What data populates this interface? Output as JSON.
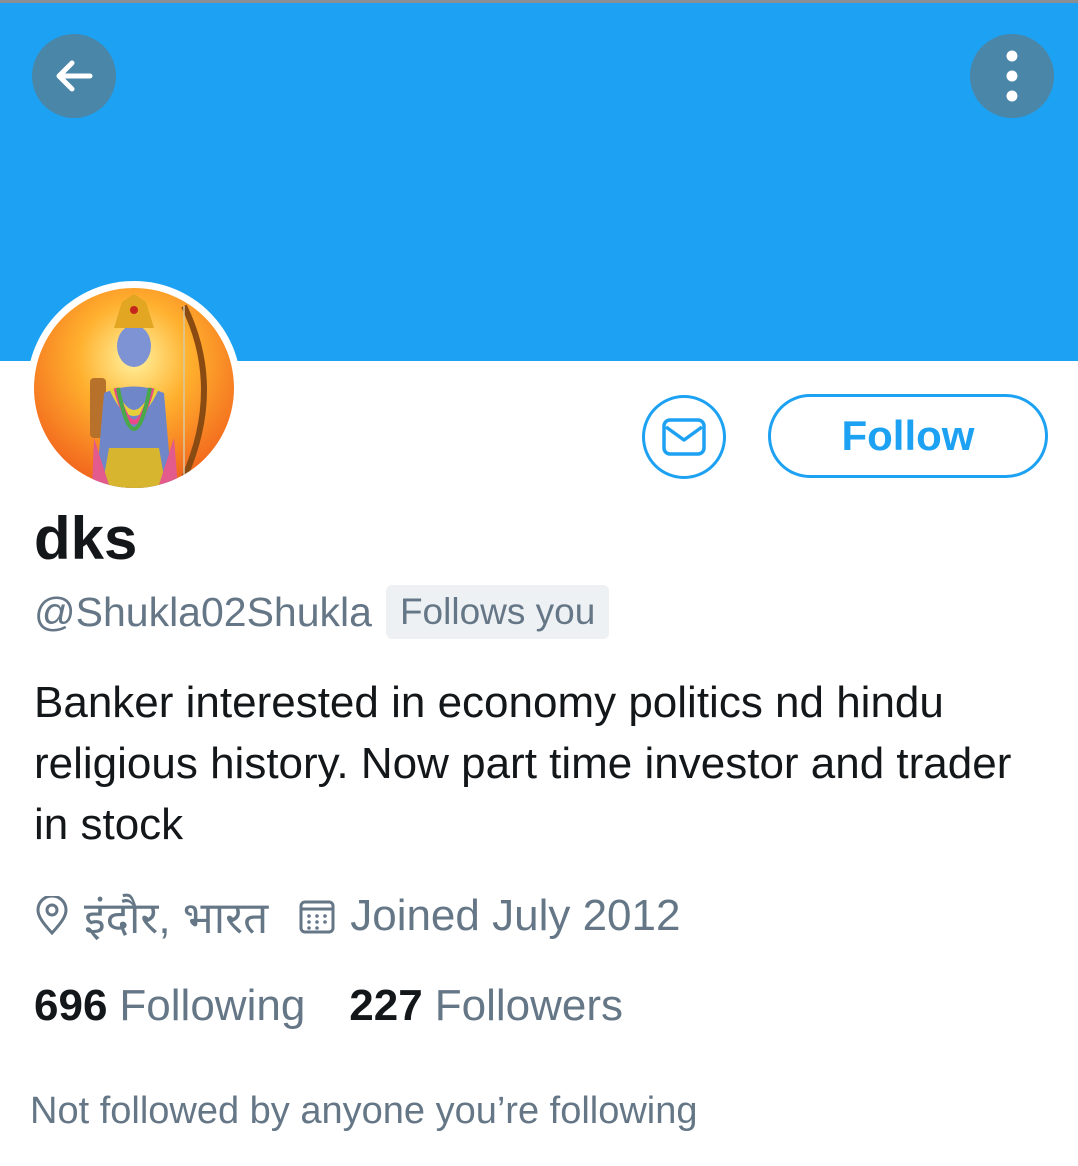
{
  "header": {
    "back_icon": "arrow-left-icon",
    "more_icon": "more-vertical-icon",
    "banner_color": "#1da1f2"
  },
  "profile": {
    "display_name": "dks",
    "handle": "@Shukla02Shukla",
    "follows_you_badge": "Follows you",
    "bio": "Banker interested in economy politics nd hindu religious history.  Now part time investor and trader in stock",
    "location": "इंदौर, भारत",
    "joined": "Joined July 2012"
  },
  "actions": {
    "message_icon": "envelope-icon",
    "follow_label": "Follow"
  },
  "stats": {
    "following_count": "696",
    "following_label": "Following",
    "followers_count": "227",
    "followers_label": "Followers"
  },
  "footer": {
    "not_followed_text": "Not followed by anyone you’re following"
  },
  "colors": {
    "accent": "#1da1f2",
    "secondary_text": "#657786",
    "primary_text": "#14171a"
  }
}
